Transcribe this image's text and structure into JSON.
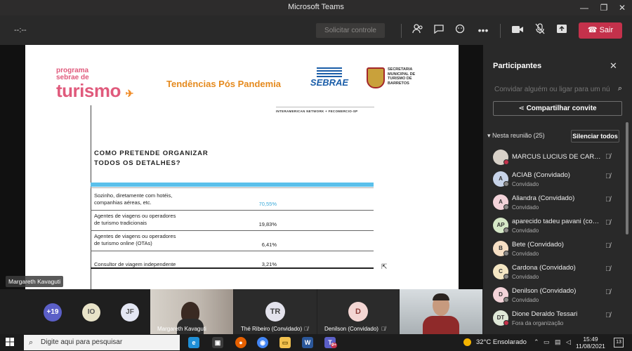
{
  "window": {
    "title": "Microsoft Teams",
    "minimize_icon": "minimize-icon",
    "maximize_icon": "maximize-icon",
    "close_icon": "close-icon"
  },
  "callbar": {
    "timer": "--:--",
    "request_control_label": "Solicitar controle",
    "leave_label": "Sair",
    "icons": [
      "participants-icon",
      "chat-icon",
      "reactions-icon",
      "more-icon",
      "camera-icon",
      "mic-off-icon",
      "share-icon",
      "phone-icon"
    ]
  },
  "slide": {
    "logo_small_1": "programa",
    "logo_small_2": "sebrae de",
    "logo_big": "turismo",
    "title": "Tendências Pós Pandemia",
    "sebrae_label": "SEBRAE",
    "secretaria": "SECRETARIA\nMUNICIPAL DE\nTURISMO DE\nBARRETOS",
    "network": "INTERAMERICAN NETWORK + FECOMERCIO-SP",
    "question": "COMO PRETENDE ORGANIZAR\nTODOS OS DETALHES?",
    "rows": [
      {
        "label": "Sozinho, diretamente com hotéis,\ncompanhias aéreas, etc.",
        "value": "70,55%"
      },
      {
        "label": "Agentes de viagens ou operadores\nde turismo tradicionais",
        "value": "19,83%"
      },
      {
        "label": "Agentes de viagens ou operadores\nde turismo online (OTAs)",
        "value": "6,41%"
      },
      {
        "label": "Consultor de viagem independente",
        "value": "3,21%"
      }
    ]
  },
  "stage": {
    "presenter_name": "Margareth Kavaguti"
  },
  "tiles": {
    "overflow_count": "+19",
    "chip_io": "IO",
    "chip_jf": "JF",
    "video1_name": "Margareth Kavaguti",
    "tile_the_initials": "TR",
    "tile_the_name": "Thé Ribeiro (Convidado)",
    "tile_denilson_initials": "D",
    "tile_denilson_name": "Denilson (Convidado)"
  },
  "sidebar": {
    "title": "Participantes",
    "invite_placeholder": "Convidar alguém ou ligar para um núi",
    "share_invite_label": "Compartilhar convite",
    "in_meeting_label": "Nesta reunião (25)",
    "mute_all_label": "Silenciar todos",
    "participants": [
      {
        "initials": "",
        "name": "MARCUS LUCIUS DE CARVAL...",
        "sub": ""
      },
      {
        "initials": "A",
        "name": "ACIAB (Convidado)",
        "sub": "Convidado"
      },
      {
        "initials": "A",
        "name": "Aliandra (Convidado)",
        "sub": "Convidado"
      },
      {
        "initials": "AP",
        "name": "aparecido tadeu pavani (conv...",
        "sub": "Convidado"
      },
      {
        "initials": "B",
        "name": "Bete (Convidado)",
        "sub": "Convidado"
      },
      {
        "initials": "C",
        "name": "Cardona (Convidado)",
        "sub": "Convidado"
      },
      {
        "initials": "D",
        "name": "Denilson (Convidado)",
        "sub": "Convidado"
      },
      {
        "initials": "DT",
        "name": "Dione Deraldo Tessari",
        "sub": "Fora da organização"
      }
    ]
  },
  "taskbar": {
    "search_placeholder": "Digite aqui para pesquisar",
    "weather": "32°C  Ensolarado",
    "time": "15:49",
    "date": "11/08/2021",
    "notif_count": "13",
    "teams_badge": "9+"
  },
  "colors": {
    "leave_red": "#c4314b",
    "highlight_blue": "#38a9d9",
    "slide_title_orange": "#e58a1e"
  }
}
